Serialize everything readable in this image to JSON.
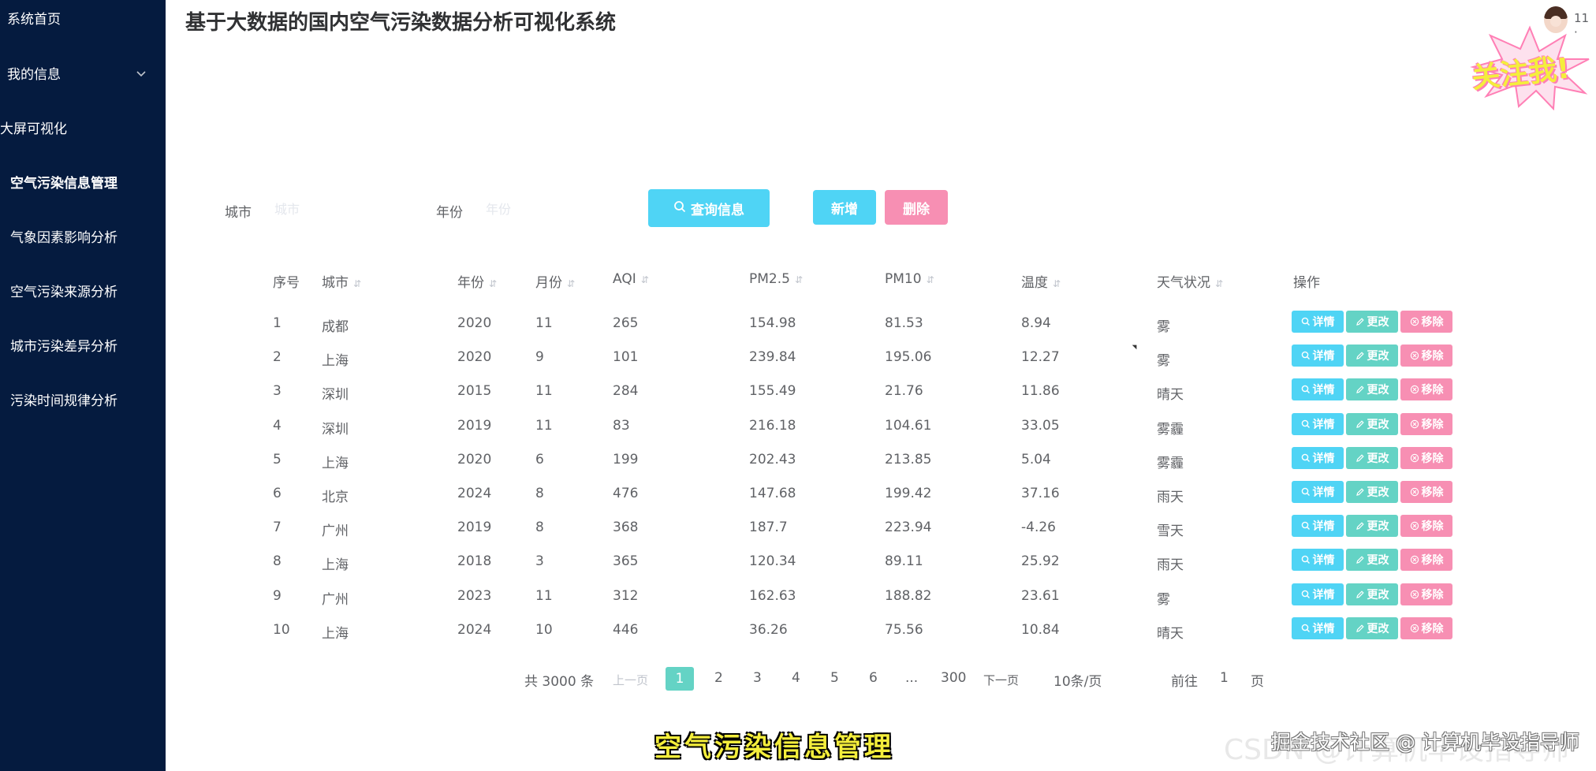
{
  "sidebar": {
    "items": [
      {
        "label": "系统首页"
      },
      {
        "label": "我的信息",
        "chevron": "chevron-down-icon"
      },
      {
        "label": "大屏可视化"
      },
      {
        "label": "空气污染信息管理",
        "active": true
      },
      {
        "label": "气象因素影响分析"
      },
      {
        "label": "空气污染来源分析"
      },
      {
        "label": "城市污染差异分析"
      },
      {
        "label": "污染时间规律分析"
      }
    ]
  },
  "header": {
    "title": "基于大数据的国内空气污染数据分析可视化系统",
    "user": "11 ·",
    "sticker_text": "关注我!"
  },
  "search": {
    "city_label": "城市",
    "city_placeholder": "城市",
    "year_label": "年份",
    "year_placeholder": "年份",
    "query_button": "查询信息",
    "query_icon": "search-icon",
    "add_button": "新增",
    "delete_button": "删除"
  },
  "table": {
    "headers": [
      "序号",
      "城市",
      "年份",
      "月份",
      "AQI",
      "PM2.5",
      "PM10",
      "温度",
      "天气状况",
      "操作"
    ],
    "rows": [
      {
        "no": "1",
        "city": "成都",
        "year": "2020",
        "month": "11",
        "aqi": "265",
        "pm25": "154.98",
        "pm10": "81.53",
        "temp": "8.94",
        "weather": "雾"
      },
      {
        "no": "2",
        "city": "上海",
        "year": "2020",
        "month": "9",
        "aqi": "101",
        "pm25": "239.84",
        "pm10": "195.06",
        "temp": "12.27",
        "weather": "雾"
      },
      {
        "no": "3",
        "city": "深圳",
        "year": "2015",
        "month": "11",
        "aqi": "284",
        "pm25": "155.49",
        "pm10": "21.76",
        "temp": "11.86",
        "weather": "晴天"
      },
      {
        "no": "4",
        "city": "深圳",
        "year": "2019",
        "month": "11",
        "aqi": "83",
        "pm25": "216.18",
        "pm10": "104.61",
        "temp": "33.05",
        "weather": "雾霾"
      },
      {
        "no": "5",
        "city": "上海",
        "year": "2020",
        "month": "6",
        "aqi": "199",
        "pm25": "202.43",
        "pm10": "213.85",
        "temp": "5.04",
        "weather": "雾霾"
      },
      {
        "no": "6",
        "city": "北京",
        "year": "2024",
        "month": "8",
        "aqi": "476",
        "pm25": "147.68",
        "pm10": "199.42",
        "temp": "37.16",
        "weather": "雨天"
      },
      {
        "no": "7",
        "city": "广州",
        "year": "2019",
        "month": "8",
        "aqi": "368",
        "pm25": "187.7",
        "pm10": "223.94",
        "temp": "-4.26",
        "weather": "雪天"
      },
      {
        "no": "8",
        "city": "上海",
        "year": "2018",
        "month": "3",
        "aqi": "365",
        "pm25": "120.34",
        "pm10": "89.11",
        "temp": "25.92",
        "weather": "雨天"
      },
      {
        "no": "9",
        "city": "广州",
        "year": "2023",
        "month": "11",
        "aqi": "312",
        "pm25": "162.63",
        "pm10": "188.82",
        "temp": "23.61",
        "weather": "雾"
      },
      {
        "no": "10",
        "city": "上海",
        "year": "2024",
        "month": "10",
        "aqi": "446",
        "pm25": "36.26",
        "pm10": "75.56",
        "temp": "10.84",
        "weather": "晴天"
      }
    ],
    "actions": {
      "detail": "详情",
      "edit": "更改",
      "remove": "移除"
    }
  },
  "pagination": {
    "total": "共 3000 条",
    "prev": "上一页",
    "pages": [
      "1",
      "2",
      "3",
      "4",
      "5",
      "6",
      "...",
      "300"
    ],
    "current": "1",
    "next": "下一页",
    "page_size": "10条/页",
    "goto_label": "前往",
    "goto_value": "1",
    "goto_suffix": "页"
  },
  "overlay": {
    "caption": "空气污染信息管理",
    "watermark_back": "CSDN @计算机毕设指导师",
    "watermark_front": "掘金技术社区 @ 计算机毕设指导师"
  },
  "colors": {
    "sidebar_bg": "#051b3f",
    "accent_cyan": "#4fd4f5",
    "accent_teal": "#64d3c5",
    "accent_pink": "#f78fb3"
  }
}
